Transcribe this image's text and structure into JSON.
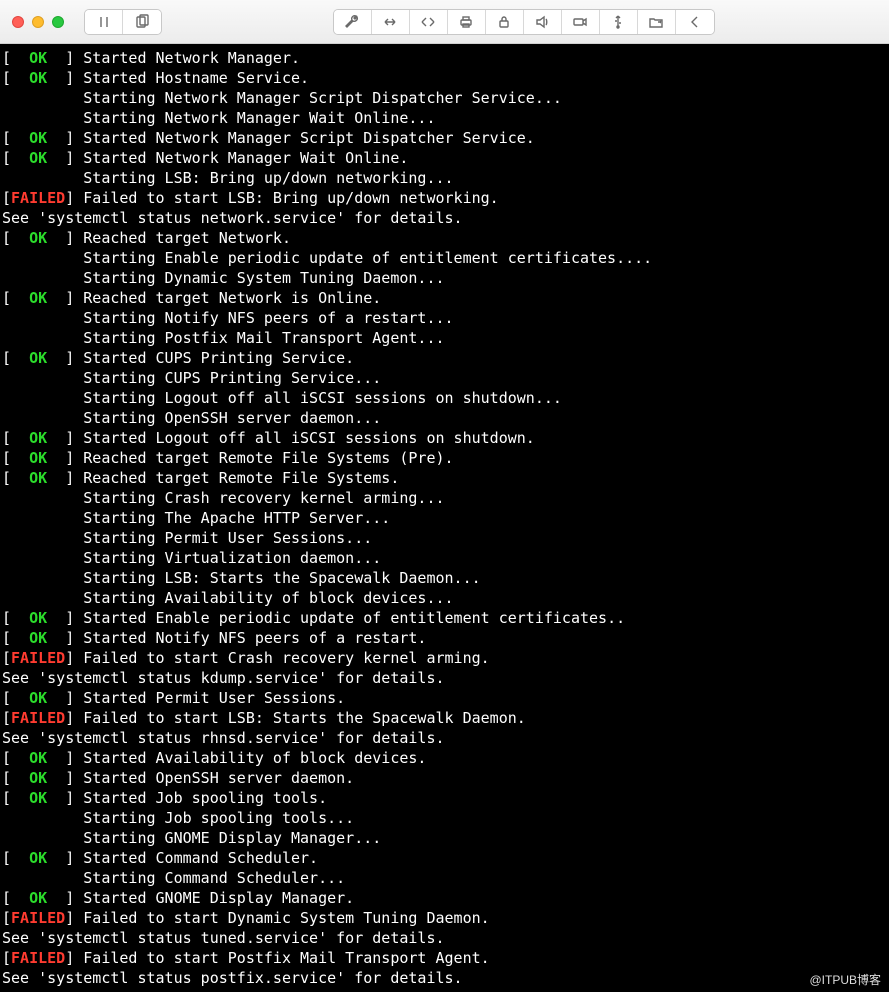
{
  "watermark": "@ITPUB博客",
  "status": {
    "ok": "OK",
    "failed": "FAILED"
  },
  "lines": [
    {
      "status": "ok",
      "text": "Started Network Manager."
    },
    {
      "status": "ok",
      "text": "Started Hostname Service."
    },
    {
      "status": "none",
      "text": "Starting Network Manager Script Dispatcher Service..."
    },
    {
      "status": "none",
      "text": "Starting Network Manager Wait Online..."
    },
    {
      "status": "ok",
      "text": "Started Network Manager Script Dispatcher Service."
    },
    {
      "status": "ok",
      "text": "Started Network Manager Wait Online."
    },
    {
      "status": "none",
      "text": "Starting LSB: Bring up/down networking..."
    },
    {
      "status": "failed",
      "text": "Failed to start LSB: Bring up/down networking."
    },
    {
      "status": "plain",
      "text": "See 'systemctl status network.service' for details."
    },
    {
      "status": "ok",
      "text": "Reached target Network."
    },
    {
      "status": "none",
      "text": "Starting Enable periodic update of entitlement certificates...."
    },
    {
      "status": "none",
      "text": "Starting Dynamic System Tuning Daemon..."
    },
    {
      "status": "ok",
      "text": "Reached target Network is Online."
    },
    {
      "status": "none",
      "text": "Starting Notify NFS peers of a restart..."
    },
    {
      "status": "none",
      "text": "Starting Postfix Mail Transport Agent..."
    },
    {
      "status": "ok",
      "text": "Started CUPS Printing Service."
    },
    {
      "status": "none",
      "text": "Starting CUPS Printing Service..."
    },
    {
      "status": "none",
      "text": "Starting Logout off all iSCSI sessions on shutdown..."
    },
    {
      "status": "none",
      "text": "Starting OpenSSH server daemon..."
    },
    {
      "status": "ok",
      "text": "Started Logout off all iSCSI sessions on shutdown."
    },
    {
      "status": "ok",
      "text": "Reached target Remote File Systems (Pre)."
    },
    {
      "status": "ok",
      "text": "Reached target Remote File Systems."
    },
    {
      "status": "none",
      "text": "Starting Crash recovery kernel arming..."
    },
    {
      "status": "none",
      "text": "Starting The Apache HTTP Server..."
    },
    {
      "status": "none",
      "text": "Starting Permit User Sessions..."
    },
    {
      "status": "none",
      "text": "Starting Virtualization daemon..."
    },
    {
      "status": "none",
      "text": "Starting LSB: Starts the Spacewalk Daemon..."
    },
    {
      "status": "none",
      "text": "Starting Availability of block devices..."
    },
    {
      "status": "ok",
      "text": "Started Enable periodic update of entitlement certificates.."
    },
    {
      "status": "ok",
      "text": "Started Notify NFS peers of a restart."
    },
    {
      "status": "failed",
      "text": "Failed to start Crash recovery kernel arming."
    },
    {
      "status": "plain",
      "text": "See 'systemctl status kdump.service' for details."
    },
    {
      "status": "ok",
      "text": "Started Permit User Sessions."
    },
    {
      "status": "failed",
      "text": "Failed to start LSB: Starts the Spacewalk Daemon."
    },
    {
      "status": "plain",
      "text": "See 'systemctl status rhnsd.service' for details."
    },
    {
      "status": "ok",
      "text": "Started Availability of block devices."
    },
    {
      "status": "ok",
      "text": "Started OpenSSH server daemon."
    },
    {
      "status": "ok",
      "text": "Started Job spooling tools."
    },
    {
      "status": "none",
      "text": "Starting Job spooling tools..."
    },
    {
      "status": "none",
      "text": "Starting GNOME Display Manager..."
    },
    {
      "status": "ok",
      "text": "Started Command Scheduler."
    },
    {
      "status": "none",
      "text": "Starting Command Scheduler..."
    },
    {
      "status": "ok",
      "text": "Started GNOME Display Manager."
    },
    {
      "status": "failed",
      "text": "Failed to start Dynamic System Tuning Daemon."
    },
    {
      "status": "plain",
      "text": "See 'systemctl status tuned.service' for details."
    },
    {
      "status": "failed",
      "text": "Failed to start Postfix Mail Transport Agent."
    },
    {
      "status": "plain",
      "text": "See 'systemctl status postfix.service' for details."
    }
  ]
}
